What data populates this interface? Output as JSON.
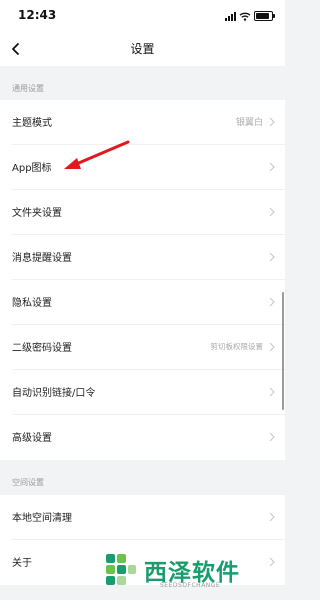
{
  "status_bar": {
    "time": "12:43"
  },
  "nav": {
    "title": "设置"
  },
  "sections": {
    "general": "通用设置",
    "space": "空间设置"
  },
  "rows": {
    "theme": {
      "label": "主题模式",
      "value": "银翼白"
    },
    "app_icon": {
      "label": "App图标"
    },
    "folder": {
      "label": "文件夹设置"
    },
    "notify": {
      "label": "消息提醒设置"
    },
    "privacy": {
      "label": "隐私设置"
    },
    "password": {
      "label": "二级密码设置",
      "value": "剪切板权限设置"
    },
    "autolink": {
      "label": "自动识别链接/口令"
    },
    "advanced": {
      "label": "高级设置"
    },
    "local_clean": {
      "label": "本地空间清理"
    },
    "about": {
      "label": "关于"
    }
  },
  "annotation": {
    "arrow_color": "#e0191f"
  },
  "watermark": {
    "title": "西泽软件",
    "subtitle": "SEEDSOFCHANGE",
    "color": "#1a9d6e"
  },
  "icons": [
    "wifi-icon",
    "battery-icon",
    "back-chevron-icon",
    "chevron-right-icon",
    "red-arrow-icon"
  ]
}
